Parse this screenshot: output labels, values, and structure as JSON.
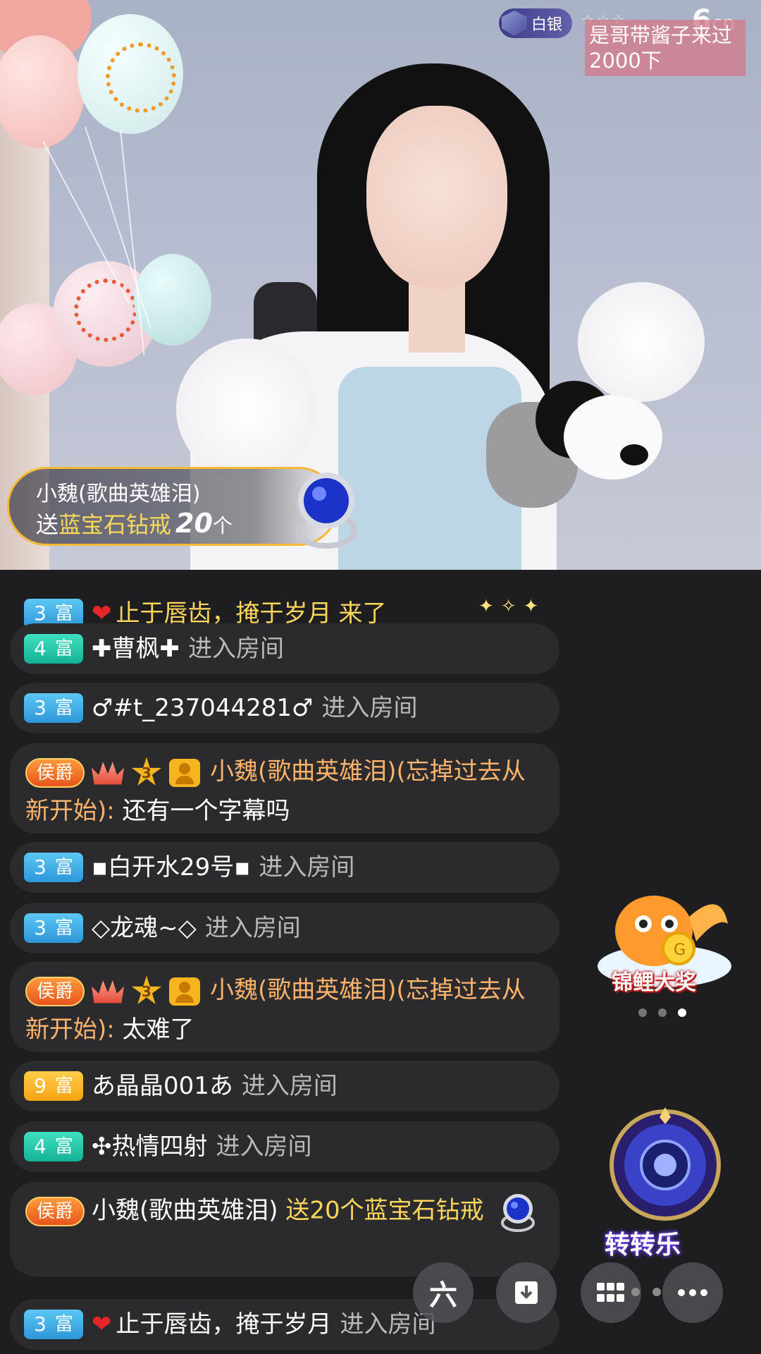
{
  "video": {
    "level_badge": "白银",
    "caption": "是哥带酱子来过2000下",
    "logo": "6",
    "logo_suffix": "cn"
  },
  "gift_banner": {
    "user": "小魏(歌曲英雄泪)",
    "send_word": "送",
    "gift_name": "蓝宝石钻戒",
    "count": "20",
    "unit": "个"
  },
  "chat": {
    "messages": [
      {
        "rich_level": "3",
        "rich_label": "富",
        "user": "止于唇齿，掩于岁月",
        "action": "来了"
      },
      {
        "rich_level": "4",
        "rich_label": "富",
        "user": "✚曹枫✚",
        "action": "进入房间"
      },
      {
        "rich_level": "3",
        "rich_label": "富",
        "user": "♂#t_237044281♂",
        "action": "进入房间"
      },
      {
        "title": "侯爵",
        "star_level": "3",
        "user": "小魏(歌曲英雄泪)(忘掉过去从新开始):",
        "text": "还有一个字幕吗"
      },
      {
        "rich_level": "3",
        "rich_label": "富",
        "user": "▪白开水29号▪",
        "action": "进入房间"
      },
      {
        "rich_level": "3",
        "rich_label": "富",
        "user": "◇龙魂~◇",
        "action": "进入房间"
      },
      {
        "title": "侯爵",
        "star_level": "3",
        "user": "小魏(歌曲英雄泪)(忘掉过去从新开始):",
        "text": "太难了"
      },
      {
        "rich_level": "9",
        "rich_label": "富",
        "user": "あ晶晶001あ",
        "action": "进入房间"
      },
      {
        "rich_level": "4",
        "rich_label": "富",
        "user": "✣热情四射",
        "action": "进入房间"
      },
      {
        "title": "侯爵",
        "user": "小魏(歌曲英雄泪)",
        "text": "送20个蓝宝石钻戒"
      },
      {
        "rich_level": "3",
        "rich_label": "富",
        "user": "止于唇齿，掩于岁月",
        "action": "进入房间"
      }
    ]
  },
  "widgets": {
    "koi_label": "锦鲤大奖",
    "spin_label": "转转乐"
  },
  "actions": {
    "share_icon": "六",
    "icons": [
      "six-logo-icon",
      "download-icon",
      "grid-icon",
      "more-icon"
    ]
  },
  "colors": {
    "accent_gold": "#f5b935",
    "rich3": "#2e97da",
    "rich4": "#15b295",
    "rich9": "#f5a412",
    "duke": "#e8541c"
  }
}
